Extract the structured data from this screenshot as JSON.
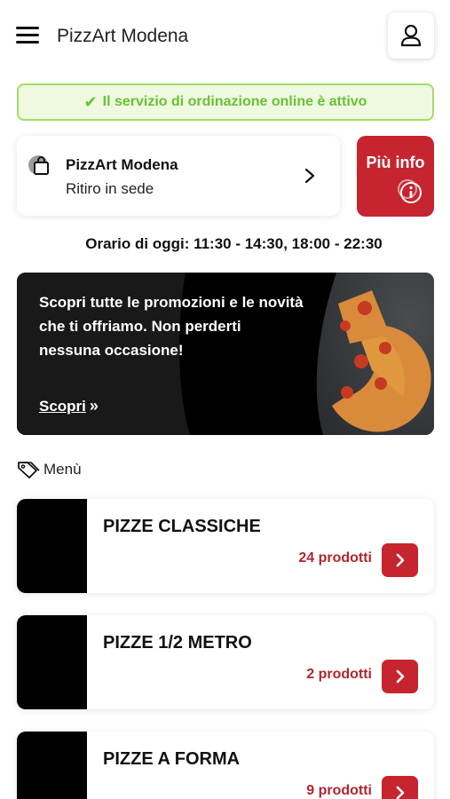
{
  "header": {
    "title": "PizzArt Modena",
    "menu_icon": "hamburger-icon",
    "user_icon": "user-icon"
  },
  "status": {
    "text": "Il servizio di ordinazione online è attivo",
    "check": "✔",
    "color": "#6cc035"
  },
  "store": {
    "name": "PizzArt Modena",
    "mode": "Ritiro in sede",
    "icon": "shopping-bag-icon"
  },
  "info_button": {
    "label": "Più info",
    "icon": "info-icon",
    "color": "#c6242e"
  },
  "hours": {
    "text": "Orario di oggi: 11:30 - 14:30, 18:00 - 22:30"
  },
  "promo": {
    "text": "Scopri tutte le promozioni e le novità che ti offriamo. Non perderti nessuna occasione!",
    "link_label": "Scopri",
    "link_arrows": "»"
  },
  "menu": {
    "label": "Menù",
    "icon": "tag-icon"
  },
  "categories": [
    {
      "name": "PIZZE CLASSICHE",
      "count": "24 prodotti"
    },
    {
      "name": "PIZZE 1/2 METRO",
      "count": "2 prodotti"
    },
    {
      "name": "PIZZE A FORMA",
      "count": "9 prodotti"
    }
  ]
}
